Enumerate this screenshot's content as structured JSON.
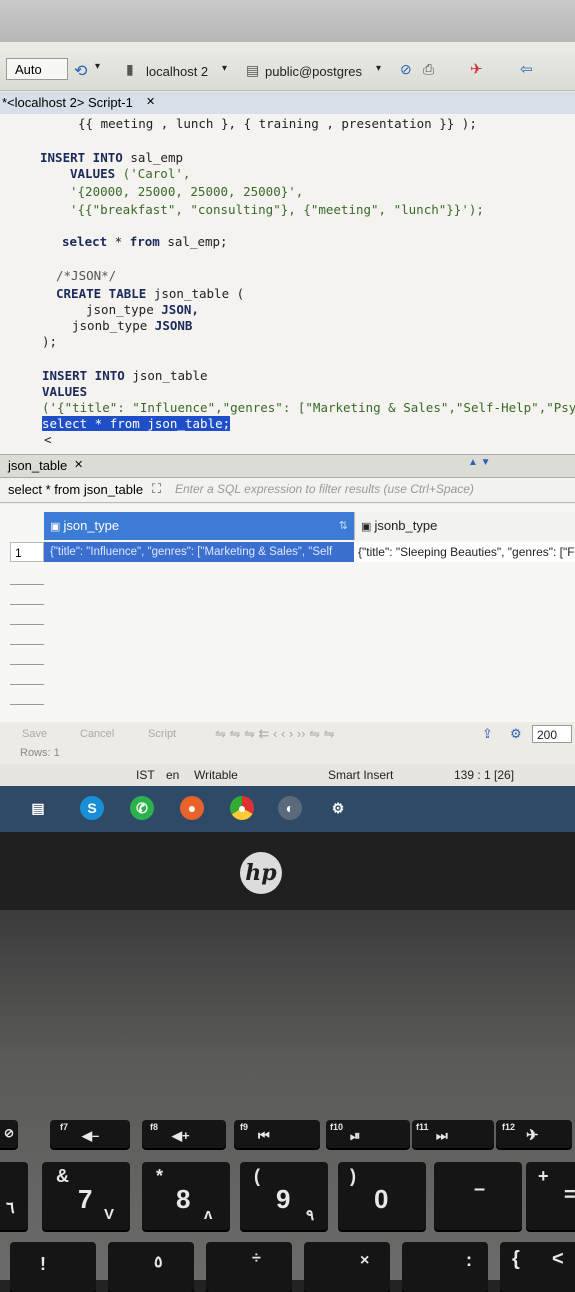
{
  "toolbar": {
    "mode": "Auto",
    "connection": "localhost 2",
    "database": "public@postgres"
  },
  "editor_tab": {
    "title": "*<localhost 2> Script-1"
  },
  "code": {
    "l0": "{{ meeting , lunch }, { training , presentation }} );",
    "l1a": "INSERT INTO",
    "l1b": " sal_emp",
    "l2a": "VALUES",
    "l2b": " ('Carol',",
    "l3": "'{20000, 25000, 25000, 25000}',",
    "l4": "'{{\"breakfast\", \"consulting\"}, {\"meeting\", \"lunch\"}}');",
    "l5a": "select",
    "l5b": " * ",
    "l5c": "from",
    "l5d": " sal_emp;",
    "l6": "/*JSON*/",
    "l7a": "CREATE TABLE",
    "l7b": " json_table (",
    "l8a": "json_type ",
    "l8b": "JSON,",
    "l9a": "jsonb_type ",
    "l9b": "JSONB",
    "l10": ");",
    "l11a": "INSERT INTO",
    "l11b": " json_table",
    "l12": "VALUES",
    "l13": "('{\"title\": \"Influence\",\"genres\": [\"Marketing & Sales\",\"Self-Help\",\"Psych",
    "l14": "select * from json_table;",
    "l15": "<"
  },
  "results": {
    "tab": "json_table",
    "query": "select * from json_table",
    "filter_placeholder": "Enter a SQL expression to filter results (use Ctrl+Space)",
    "columns": [
      "json_type",
      "jsonb_type"
    ],
    "row_number": "1",
    "cell_json": "{\"title\": \"Influence\", \"genres\": [\"Marketing & Sales\", \"Self",
    "cell_jsonb": "{\"title\": \"Sleeping Beauties\", \"genres\": [\"F",
    "toolbar": {
      "save": "Save",
      "cancel": "Cancel",
      "script": "Script",
      "fetch_size": "200"
    },
    "rows": "Rows: 1"
  },
  "status": {
    "timezone": "IST",
    "locale": "en",
    "mode": "Writable",
    "insert": "Smart Insert",
    "position": "139 : 1 [26]"
  },
  "taskbar": {
    "skype_letter": "S"
  },
  "laptop": {
    "brand": "hp",
    "keys": {
      "f7": "f7",
      "f8": "f8",
      "f9": "f9",
      "f10": "f10",
      "f11": "f11",
      "f12": "f12",
      "k7": "7",
      "k7s": "&",
      "k8": "8",
      "k8s": "*",
      "k9": "9",
      "k9s": "(",
      "k0": "0",
      "k0s": ")"
    }
  },
  "colors": {
    "selection": "#1f4fc8",
    "grid_selected": "#3a6fd0",
    "taskbar": "#2f4a66"
  }
}
